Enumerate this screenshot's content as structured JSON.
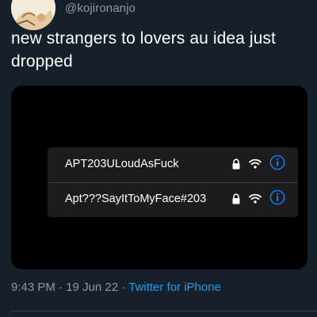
{
  "tweet": {
    "handle": "@kojironanjo",
    "text": "new strangers to lovers au idea just dropped",
    "time": "9:43 PM",
    "date": "19 Jun 22",
    "separator": "·",
    "source": "Twitter for iPhone"
  },
  "wifi_list": {
    "networks": [
      {
        "name": "APT203ULoudAsFuck",
        "secured": true
      },
      {
        "name": "Apt???SayItToMyFace#203",
        "secured": true
      }
    ]
  },
  "colors": {
    "background": "#15202b",
    "secondary_text": "#8b98a5",
    "link": "#1d9bf0",
    "info_icon": "#0a84ff"
  }
}
